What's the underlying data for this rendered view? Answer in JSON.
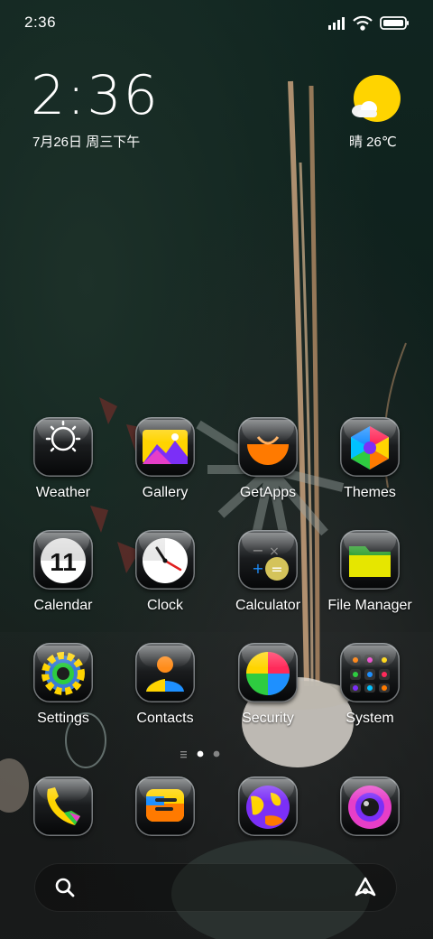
{
  "status_bar": {
    "time": "2:36",
    "signal_icon": "signal-icon",
    "wifi_icon": "wifi-icon",
    "battery_icon": "battery-icon"
  },
  "clock_widget": {
    "time": "2:36",
    "date": "7月26日 周三下午"
  },
  "weather_widget": {
    "icon": "sun-cloud-icon",
    "text": "晴 26℃"
  },
  "apps": [
    {
      "label": "Weather",
      "icon": "weather-icon"
    },
    {
      "label": "Gallery",
      "icon": "gallery-icon"
    },
    {
      "label": "GetApps",
      "icon": "getapps-icon"
    },
    {
      "label": "Themes",
      "icon": "themes-icon"
    },
    {
      "label": "Calendar",
      "icon": "calendar-icon",
      "badge_text": "11"
    },
    {
      "label": "Clock",
      "icon": "clock-icon"
    },
    {
      "label": "Calculator",
      "icon": "calculator-icon"
    },
    {
      "label": "File Manager",
      "icon": "file-manager-icon"
    },
    {
      "label": "Settings",
      "icon": "settings-icon"
    },
    {
      "label": "Contacts",
      "icon": "contacts-icon"
    },
    {
      "label": "Security",
      "icon": "security-icon"
    },
    {
      "label": "System",
      "icon": "system-folder-icon"
    }
  ],
  "page_indicator": {
    "pages": 2,
    "active": 1
  },
  "dock": [
    {
      "icon": "phone-icon"
    },
    {
      "icon": "messages-icon"
    },
    {
      "icon": "browser-icon"
    },
    {
      "icon": "camera-icon"
    }
  ],
  "search_bar": {
    "search_icon": "search-icon",
    "assistant_icon": "assistant-icon"
  },
  "colors": {
    "accent_yellow": "#ffd400",
    "accent_orange": "#ff7a00",
    "accent_purple": "#7b2ff7",
    "text": "#ffffff"
  }
}
